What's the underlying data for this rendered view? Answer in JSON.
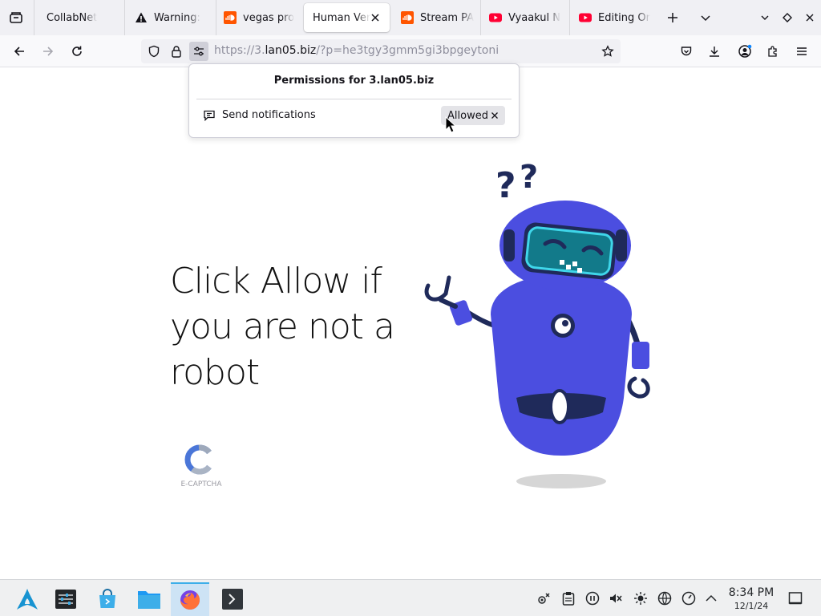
{
  "browser": {
    "tabs": [
      {
        "label": "CollabNet",
        "icon": "none"
      },
      {
        "label": "Warning: ",
        "icon": "warning-icon"
      },
      {
        "label": "vegas pro",
        "icon": "soundcloud-icon"
      },
      {
        "label": "Human Ver",
        "icon": "none",
        "active": true
      },
      {
        "label": "Stream PA",
        "icon": "soundcloud-icon"
      },
      {
        "label": "Vyaakul N",
        "icon": "youtube-icon"
      },
      {
        "label": "Editing Or",
        "icon": "youtube-icon"
      }
    ],
    "url_scheme": "https://3.",
    "url_host": "lan05.biz",
    "url_path": "/?p=he3tgy3gmm5gi3bpgeytoni"
  },
  "permissions_panel": {
    "title": "Permissions for 3.lan05.biz",
    "row_label": "Send notifications",
    "row_state": "Allowed"
  },
  "page": {
    "headline": "Click Allow if you are not a robot",
    "captcha_label": "E-CAPTCHA"
  },
  "taskbar": {
    "time": "8:34 PM",
    "date": "12/1/24"
  },
  "colors": {
    "robot_body": "#4b4ee0",
    "robot_dark": "#1f2a5a",
    "visor": "#1fbfd4",
    "youtube": "#ff0033",
    "soundcloud": "#ff5500",
    "accent": "#3daee9"
  }
}
